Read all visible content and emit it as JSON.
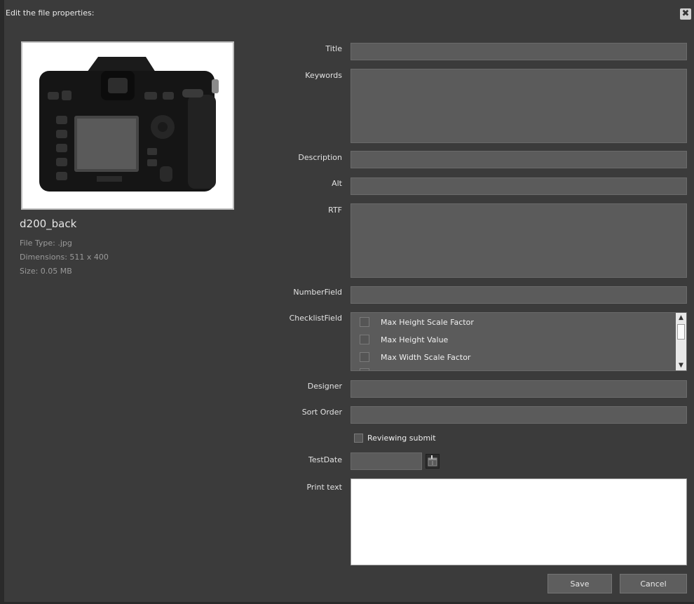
{
  "dialog": {
    "title": "Edit the file properties:",
    "close_glyph": "✖"
  },
  "file": {
    "name": "d200_back",
    "type": "File Type: .jpg",
    "dimensions": "Dimensions: 511 x 400",
    "size": "Size: 0.05 MB",
    "image_icon": "camera-image"
  },
  "fields": {
    "title_label": "Title",
    "title_value": "",
    "keywords_label": "Keywords",
    "keywords_value": "",
    "description_label": "Description",
    "description_value": "",
    "alt_label": "Alt",
    "alt_value": "",
    "rtf_label": "RTF",
    "rtf_value": "",
    "numberfield_label": "NumberField",
    "numberfield_value": "",
    "checklist_label": "ChecklistField",
    "checklist_items": [
      {
        "label": "Max Height Scale Factor",
        "checked": false
      },
      {
        "label": "Max Height Value",
        "checked": false
      },
      {
        "label": "Max Width Scale Factor",
        "checked": false
      }
    ],
    "designer_label": "Designer",
    "designer_value": "",
    "sortorder_label": "Sort Order",
    "sortorder_value": "",
    "reviewing_label": "Reviewing submit",
    "reviewing_checked": false,
    "testdate_label": "TestDate",
    "testdate_value": "",
    "printtext_label": "Print text",
    "printtext_value": ""
  },
  "buttons": {
    "save": "Save",
    "cancel": "Cancel"
  },
  "icons": {
    "scroll_up": "▲",
    "scroll_down": "▼",
    "calendar": "calendar-icon"
  },
  "colors": {
    "background": "#3b3b3b",
    "field_bg": "#5b5b5b",
    "button_bg": "#5e5e5e"
  }
}
